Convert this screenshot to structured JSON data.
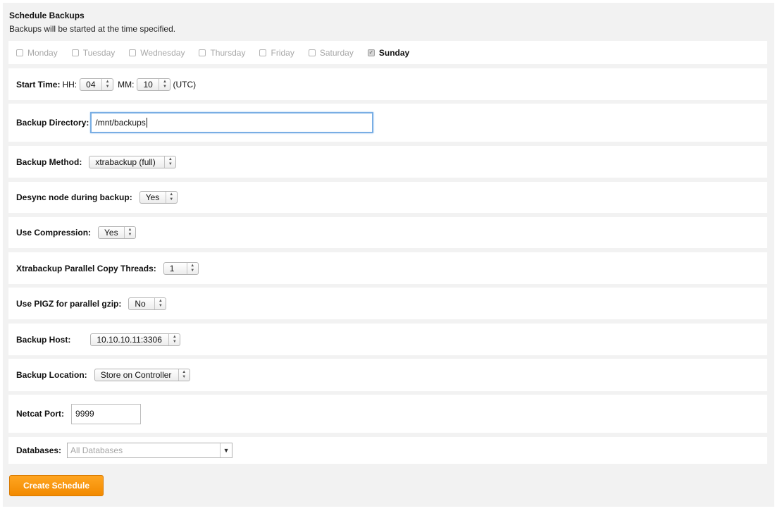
{
  "header": {
    "title": "Schedule Backups",
    "subtitle": "Backups will be started at the time specified."
  },
  "days": [
    {
      "label": "Monday",
      "checked": false
    },
    {
      "label": "Tuesday",
      "checked": false
    },
    {
      "label": "Wednesday",
      "checked": false
    },
    {
      "label": "Thursday",
      "checked": false
    },
    {
      "label": "Friday",
      "checked": false
    },
    {
      "label": "Saturday",
      "checked": false
    },
    {
      "label": "Sunday",
      "checked": true
    }
  ],
  "start_time": {
    "label": "Start Time:",
    "hh_label": "HH:",
    "hh_value": "04",
    "mm_label": "MM:",
    "mm_value": "10",
    "tz": "(UTC)"
  },
  "backup_directory": {
    "label": "Backup Directory:",
    "value": "/mnt/backups"
  },
  "backup_method": {
    "label": "Backup Method:",
    "value": "xtrabackup (full)"
  },
  "desync": {
    "label": "Desync node during backup:",
    "value": "Yes"
  },
  "compression": {
    "label": "Use Compression:",
    "value": "Yes"
  },
  "parallel_threads": {
    "label": "Xtrabackup Parallel Copy Threads:",
    "value": "1"
  },
  "pigz": {
    "label": "Use PIGZ for parallel gzip:",
    "value": "No"
  },
  "backup_host": {
    "label": "Backup Host:",
    "value": "10.10.10.11:3306"
  },
  "backup_location": {
    "label": "Backup Location:",
    "value": "Store on Controller"
  },
  "netcat_port": {
    "label": "Netcat Port:",
    "value": "9999"
  },
  "databases": {
    "label": "Databases:",
    "placeholder": "All Databases"
  },
  "create_button": {
    "label": "Create Schedule"
  },
  "colors": {
    "accent": "#f7941d",
    "focus": "#79aee4",
    "panel": "#f2f2f2"
  }
}
